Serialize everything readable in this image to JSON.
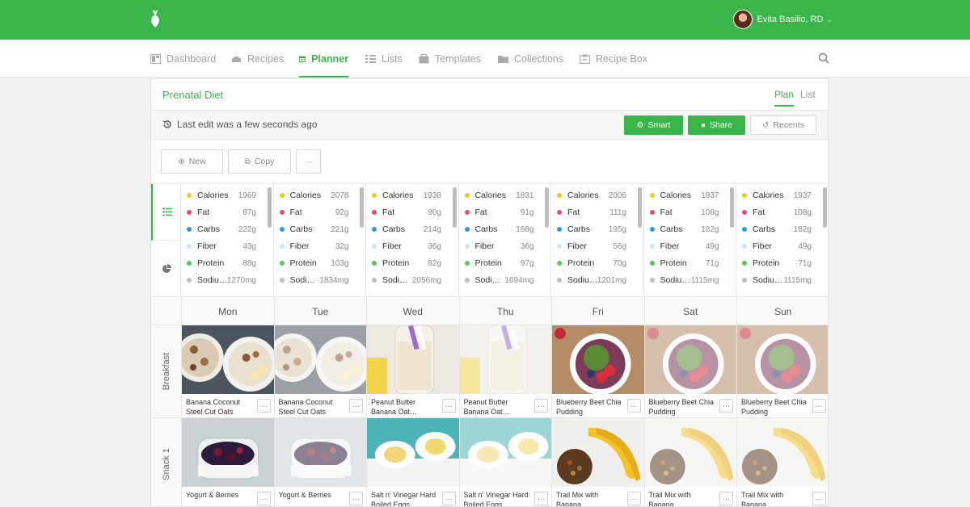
{
  "header": {
    "user_name": "Evita Basilio, RD"
  },
  "nav": [
    {
      "label": "Dashboard",
      "icon": "dashboard-icon",
      "active": false
    },
    {
      "label": "Recipes",
      "icon": "recipes-icon",
      "active": false
    },
    {
      "label": "Planner",
      "icon": "calendar-icon",
      "active": true
    },
    {
      "label": "Lists",
      "icon": "list-icon",
      "active": false
    },
    {
      "label": "Templates",
      "icon": "templates-icon",
      "active": false
    },
    {
      "label": "Collections",
      "icon": "folder-icon",
      "active": false
    },
    {
      "label": "Recipe Box",
      "icon": "recipe-box-icon",
      "active": false
    }
  ],
  "plan": {
    "title": "Prenatal Diet",
    "tab_plan": "Plan",
    "tab_list": "List",
    "last_edit": "Last edit was a few seconds ago",
    "smart_label": "Smart",
    "share_label": "Share",
    "recents_label": "Recents",
    "new_label": "New",
    "copy_label": "Copy",
    "more_label": "···"
  },
  "colors": {
    "brand": "#39b54a",
    "calories": "#f5c518",
    "fat": "#e8497a",
    "carbs": "#2b9bdc",
    "fiber": "#c7e6f5",
    "protein": "#52c75d",
    "sodium": "#bdbdbd"
  },
  "nutrition": [
    {
      "calories": "1969",
      "fat": "87g",
      "carbs": "222g",
      "fiber": "43g",
      "protein": "88g",
      "sodium_label": "Sodiu…",
      "sodium": "1270mg"
    },
    {
      "calories": "2078",
      "fat": "92g",
      "carbs": "221g",
      "fiber": "32g",
      "protein": "103g",
      "sodium_label": "Sodi…",
      "sodium": "1834mg"
    },
    {
      "calories": "1938",
      "fat": "90g",
      "carbs": "214g",
      "fiber": "36g",
      "protein": "82g",
      "sodium_label": "Sodi…",
      "sodium": "2056mg"
    },
    {
      "calories": "1831",
      "fat": "91g",
      "carbs": "168g",
      "fiber": "36g",
      "protein": "97g",
      "sodium_label": "Sodi…",
      "sodium": "1694mg"
    },
    {
      "calories": "2006",
      "fat": "111g",
      "carbs": "195g",
      "fiber": "56g",
      "protein": "70g",
      "sodium_label": "Sodiu…",
      "sodium": "1201mg"
    },
    {
      "calories": "1937",
      "fat": "108g",
      "carbs": "182g",
      "fiber": "49g",
      "protein": "71g",
      "sodium_label": "Sodiu…",
      "sodium": "1115mg"
    },
    {
      "calories": "1937",
      "fat": "108g",
      "carbs": "182g",
      "fiber": "49g",
      "protein": "71g",
      "sodium_label": "Sodiu…",
      "sodium": "1115mg"
    }
  ],
  "nutrient_labels": {
    "calories": "Calories",
    "fat": "Fat",
    "carbs": "Carbs",
    "fiber": "Fiber",
    "protein": "Protein"
  },
  "days": [
    "Mon",
    "Tue",
    "Wed",
    "Thu",
    "Fri",
    "Sat",
    "Sun"
  ],
  "meals": [
    {
      "label": "Breakfast",
      "recipes": [
        {
          "name": "Banana Coconut Steel Cut Oats",
          "photo": "oats"
        },
        {
          "name": "Banana Coconut Steel Cut Oats",
          "photo": "oats"
        },
        {
          "name": "Peanut Butter Banana Oat…",
          "photo": "smoothie"
        },
        {
          "name": "Peanut Butter Banana Oat…",
          "photo": "smoothie"
        },
        {
          "name": "Blueberry Beet Chia Pudding",
          "photo": "bowl"
        },
        {
          "name": "Blueberry Beet Chia Pudding",
          "photo": "bowl"
        },
        {
          "name": "Blueberry Beet Chia Pudding",
          "photo": "bowl"
        }
      ]
    },
    {
      "label": "Snack 1",
      "recipes": [
        {
          "name": "Yogurt & Berries",
          "photo": "yogurt"
        },
        {
          "name": "Yogurt & Berries",
          "photo": "yogurt"
        },
        {
          "name": "Salt n' Vinegar Hard Boiled Eggs",
          "photo": "eggs"
        },
        {
          "name": "Salt n' Vinegar Hard Boiled Eggs",
          "photo": "eggs"
        },
        {
          "name": "Trail Mix with Banana",
          "photo": "banana"
        },
        {
          "name": "Trail Mix with Banana",
          "photo": "banana"
        },
        {
          "name": "Trail Mix with Banana",
          "photo": "banana"
        }
      ]
    }
  ]
}
